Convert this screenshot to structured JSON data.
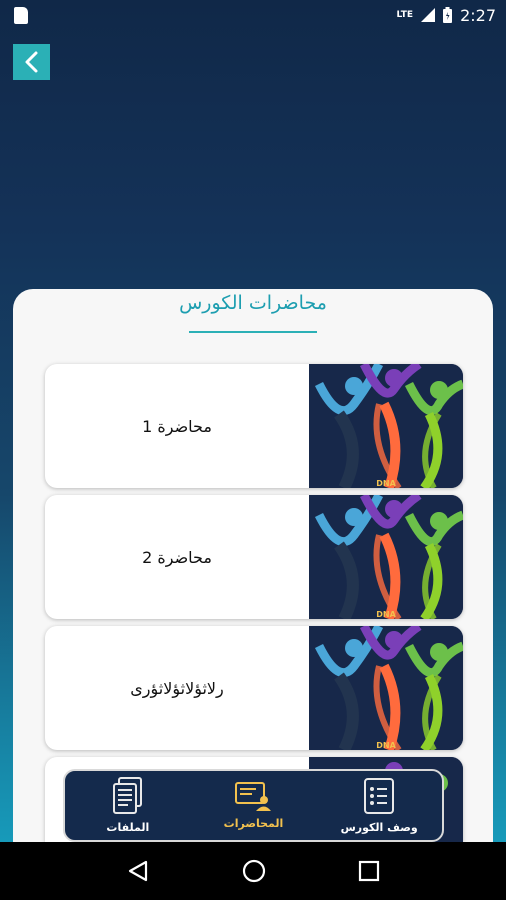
{
  "status_bar": {
    "network": "LTE",
    "time": "2:27"
  },
  "header": {
    "back_icon": "chevron-left-icon",
    "accent": "#2bb0b6"
  },
  "section": {
    "title": "محاضرات الكورس"
  },
  "lectures": [
    {
      "title": "محاضرة 1",
      "thumbnail_text": "DNA"
    },
    {
      "title": "محاضرة 2",
      "thumbnail_text": "DNA"
    },
    {
      "title": "رلاثؤلاثؤلاثؤرى",
      "thumbnail_text": "DNA"
    }
  ],
  "bottom_nav": {
    "items": [
      {
        "label": "الملفات",
        "icon": "files-icon"
      },
      {
        "label": "المحاضرات",
        "icon": "lectures-icon",
        "active": true
      },
      {
        "label": "وصف الكورس",
        "icon": "list-icon"
      }
    ],
    "active_color": "#f2c14e"
  }
}
